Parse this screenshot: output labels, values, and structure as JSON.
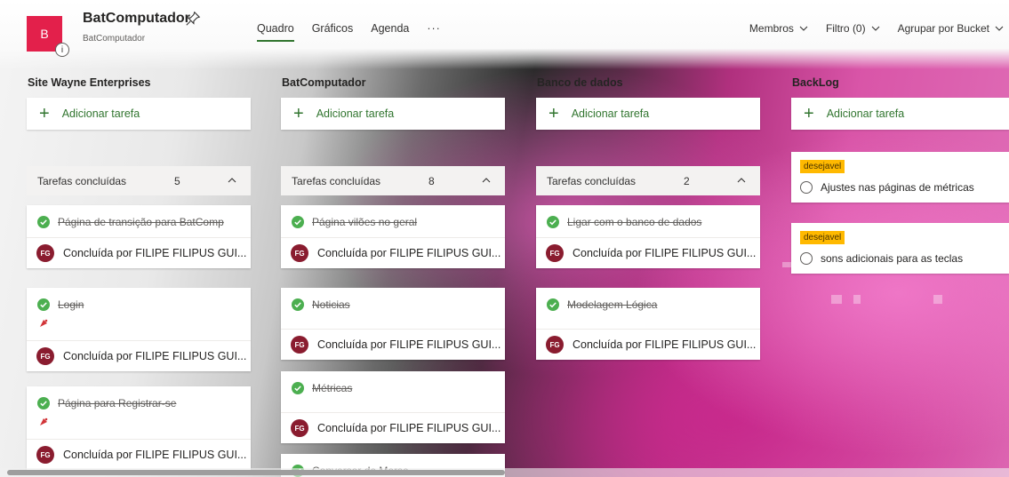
{
  "header": {
    "plan_initial": "B",
    "info_glyph": "i",
    "plan_title": "BatComputador",
    "plan_subtitle": "BatComputador",
    "tabs": [
      {
        "label": "Quadro",
        "active": true
      },
      {
        "label": "Gráficos",
        "active": false
      },
      {
        "label": "Agenda",
        "active": false
      }
    ],
    "more": "···",
    "filters": [
      {
        "label": "Membros"
      },
      {
        "label": "Filtro (0)"
      },
      {
        "label": "Agrupar por Bucket"
      }
    ]
  },
  "columns": [
    {
      "title": "Site Wayne Enterprises",
      "add_label": "Adicionar tarefa",
      "completed_label": "Tarefas concluídas",
      "completed_count": "5",
      "cards": [
        {
          "title": "Página de transição para BatComp",
          "footer": "Concluída por FILIPE FILIPUS GUI...",
          "attachment": false
        },
        {
          "title": "Login",
          "footer": "Concluída por FILIPE FILIPUS GUI...",
          "attachment": true
        },
        {
          "title": "Página para Registrar-se",
          "footer": "Concluída por FILIPE FILIPUS GUI...",
          "attachment": true
        }
      ]
    },
    {
      "title": "BatComputador",
      "add_label": "Adicionar tarefa",
      "completed_label": "Tarefas concluídas",
      "completed_count": "8",
      "cards": [
        {
          "title": "Página vilões no geral",
          "footer": "Concluída por FILIPE FILIPUS GUI...",
          "attachment": false
        },
        {
          "title": "Noticias",
          "footer": "Concluída por FILIPE FILIPUS GUI...",
          "attachment": false
        },
        {
          "title": "Métricas",
          "footer": "Concluída por FILIPE FILIPUS GUI...",
          "attachment": false
        },
        {
          "title": "Conversor de Morse",
          "footer": "",
          "attachment": false
        }
      ]
    },
    {
      "title": "Banco de dados",
      "add_label": "Adicionar tarefa",
      "completed_label": "Tarefas concluídas",
      "completed_count": "2",
      "cards": [
        {
          "title": "Ligar com o banco de dados",
          "footer": "Concluída por FILIPE FILIPUS GUI...",
          "attachment": false
        },
        {
          "title": "Modelagem Lógica",
          "footer": "Concluída por FILIPE FILIPUS GUI...",
          "attachment": false
        }
      ]
    },
    {
      "title": "BackLog",
      "add_label": "Adicionar tarefa",
      "cards": [
        {
          "label": "desejavel",
          "title": "Ajustes nas páginas de métricas"
        },
        {
          "label": "desejavel",
          "title": "sons adicionais para as teclas"
        }
      ]
    }
  ],
  "avatar_initials": "FG",
  "colors": {
    "plan_tile": "#e3204b",
    "accent_green": "#31752f",
    "avatar": "#8a1c2f",
    "label_yellow": "#ffb900",
    "check_green": "#4caf50"
  },
  "icons": {
    "pin": "pin-icon",
    "check": "check-circle-icon",
    "attachment": "attachment-icon",
    "chevron": "chevron-down-icon"
  }
}
